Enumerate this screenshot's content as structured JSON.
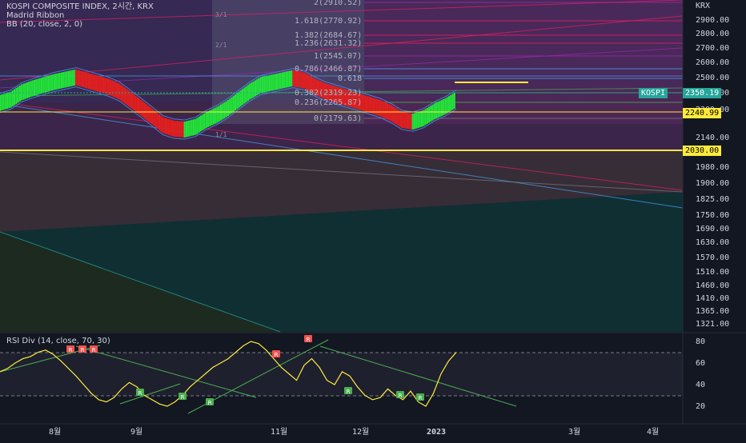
{
  "header": {
    "title": "KOSPI COMPOSITE INDEX, 2시간, KRX",
    "indicator_1": "Madrid Ribbon",
    "indicator_2": "BB (20, close, 2, 0)",
    "currency": "KRX"
  },
  "price_scale": [
    "2900.00",
    "2800.00",
    "2700.00",
    "2600.00",
    "2500.00",
    "2400.00",
    "2300.00",
    "2140.00",
    "1980.00",
    "1900.00",
    "1825.00",
    "1750.00",
    "1690.00",
    "1630.00",
    "1570.00",
    "1510.00",
    "1460.00",
    "1410.00",
    "1365.00",
    "1321.00"
  ],
  "price_tags": {
    "symbol": "KOSPI",
    "last_price": "2350.19",
    "level_1": "2240.99",
    "level_2": "2030.00",
    "colors": {
      "last": "#26a69a",
      "level": "#ffeb3b"
    }
  },
  "fib_levels": [
    {
      "ratio": "2",
      "label": "2(2910.52)"
    },
    {
      "ratio": "1.618",
      "label": "1.618(2770.92)"
    },
    {
      "ratio": "1.382",
      "label": "1.382(2684.67)"
    },
    {
      "ratio": "1.236",
      "label": "1.236(2631.32)"
    },
    {
      "ratio": "1",
      "label": "1(2545.07)"
    },
    {
      "ratio": "0.786",
      "label": "0.786(2466.87)"
    },
    {
      "ratio": "0.618",
      "label": "0.618"
    },
    {
      "ratio": "0.382",
      "label": "0.382(2319.23)"
    },
    {
      "ratio": "0.236",
      "label": "0.236(2265.87)"
    },
    {
      "ratio": "0",
      "label": "0(2179.63)"
    }
  ],
  "fan_labels": [
    "3/1",
    "2/1",
    "1/1"
  ],
  "rsi": {
    "title": "RSI Div (14, close, 70, 30)",
    "scale": [
      "80",
      "60",
      "40",
      "20"
    ],
    "bear_label": "R",
    "bull_label": "R"
  },
  "time_axis": [
    "8월",
    "9월",
    "11월",
    "12월",
    "2023",
    "3월",
    "4월"
  ],
  "chart_data": {
    "type": "line",
    "title": "KOSPI COMPOSITE INDEX, 2시간, KRX",
    "xlabel": "",
    "ylabel": "",
    "y_scale": "log",
    "ylim": [
      1300,
      2950
    ],
    "x_ticks": [
      "8월",
      "9월",
      "11월",
      "12월",
      "2023",
      "3월",
      "4월"
    ],
    "series": [
      {
        "name": "KOSPI",
        "values": [
          2330,
          2350,
          2395,
          2420,
          2440,
          2460,
          2475,
          2490,
          2470,
          2450,
          2430,
          2400,
          2350,
          2300,
          2250,
          2200,
          2180,
          2175,
          2190,
          2230,
          2260,
          2300,
          2350,
          2400,
          2440,
          2455,
          2470,
          2485,
          2470,
          2430,
          2400,
          2380,
          2360,
          2340,
          2320,
          2300,
          2270,
          2230,
          2220,
          2240,
          2280,
          2310,
          2350
        ]
      }
    ],
    "horizontal_levels": [
      2030.0,
      2240.99,
      2350.19
    ],
    "rsi_series": {
      "name": "RSI",
      "ylim": [
        10,
        90
      ],
      "thresholds": [
        70,
        30
      ],
      "values": [
        52,
        55,
        60,
        64,
        66,
        70,
        72,
        68,
        62,
        55,
        48,
        40,
        32,
        26,
        24,
        28,
        36,
        42,
        38,
        30,
        26,
        22,
        20,
        24,
        30,
        38,
        44,
        50,
        56,
        60,
        64,
        70,
        76,
        80,
        78,
        72,
        64,
        56,
        50,
        44,
        58,
        64,
        56,
        44,
        40,
        52,
        48,
        38,
        30,
        26,
        28,
        36,
        30,
        26,
        34,
        24,
        20,
        32,
        50,
        62,
        70
      ]
    }
  }
}
